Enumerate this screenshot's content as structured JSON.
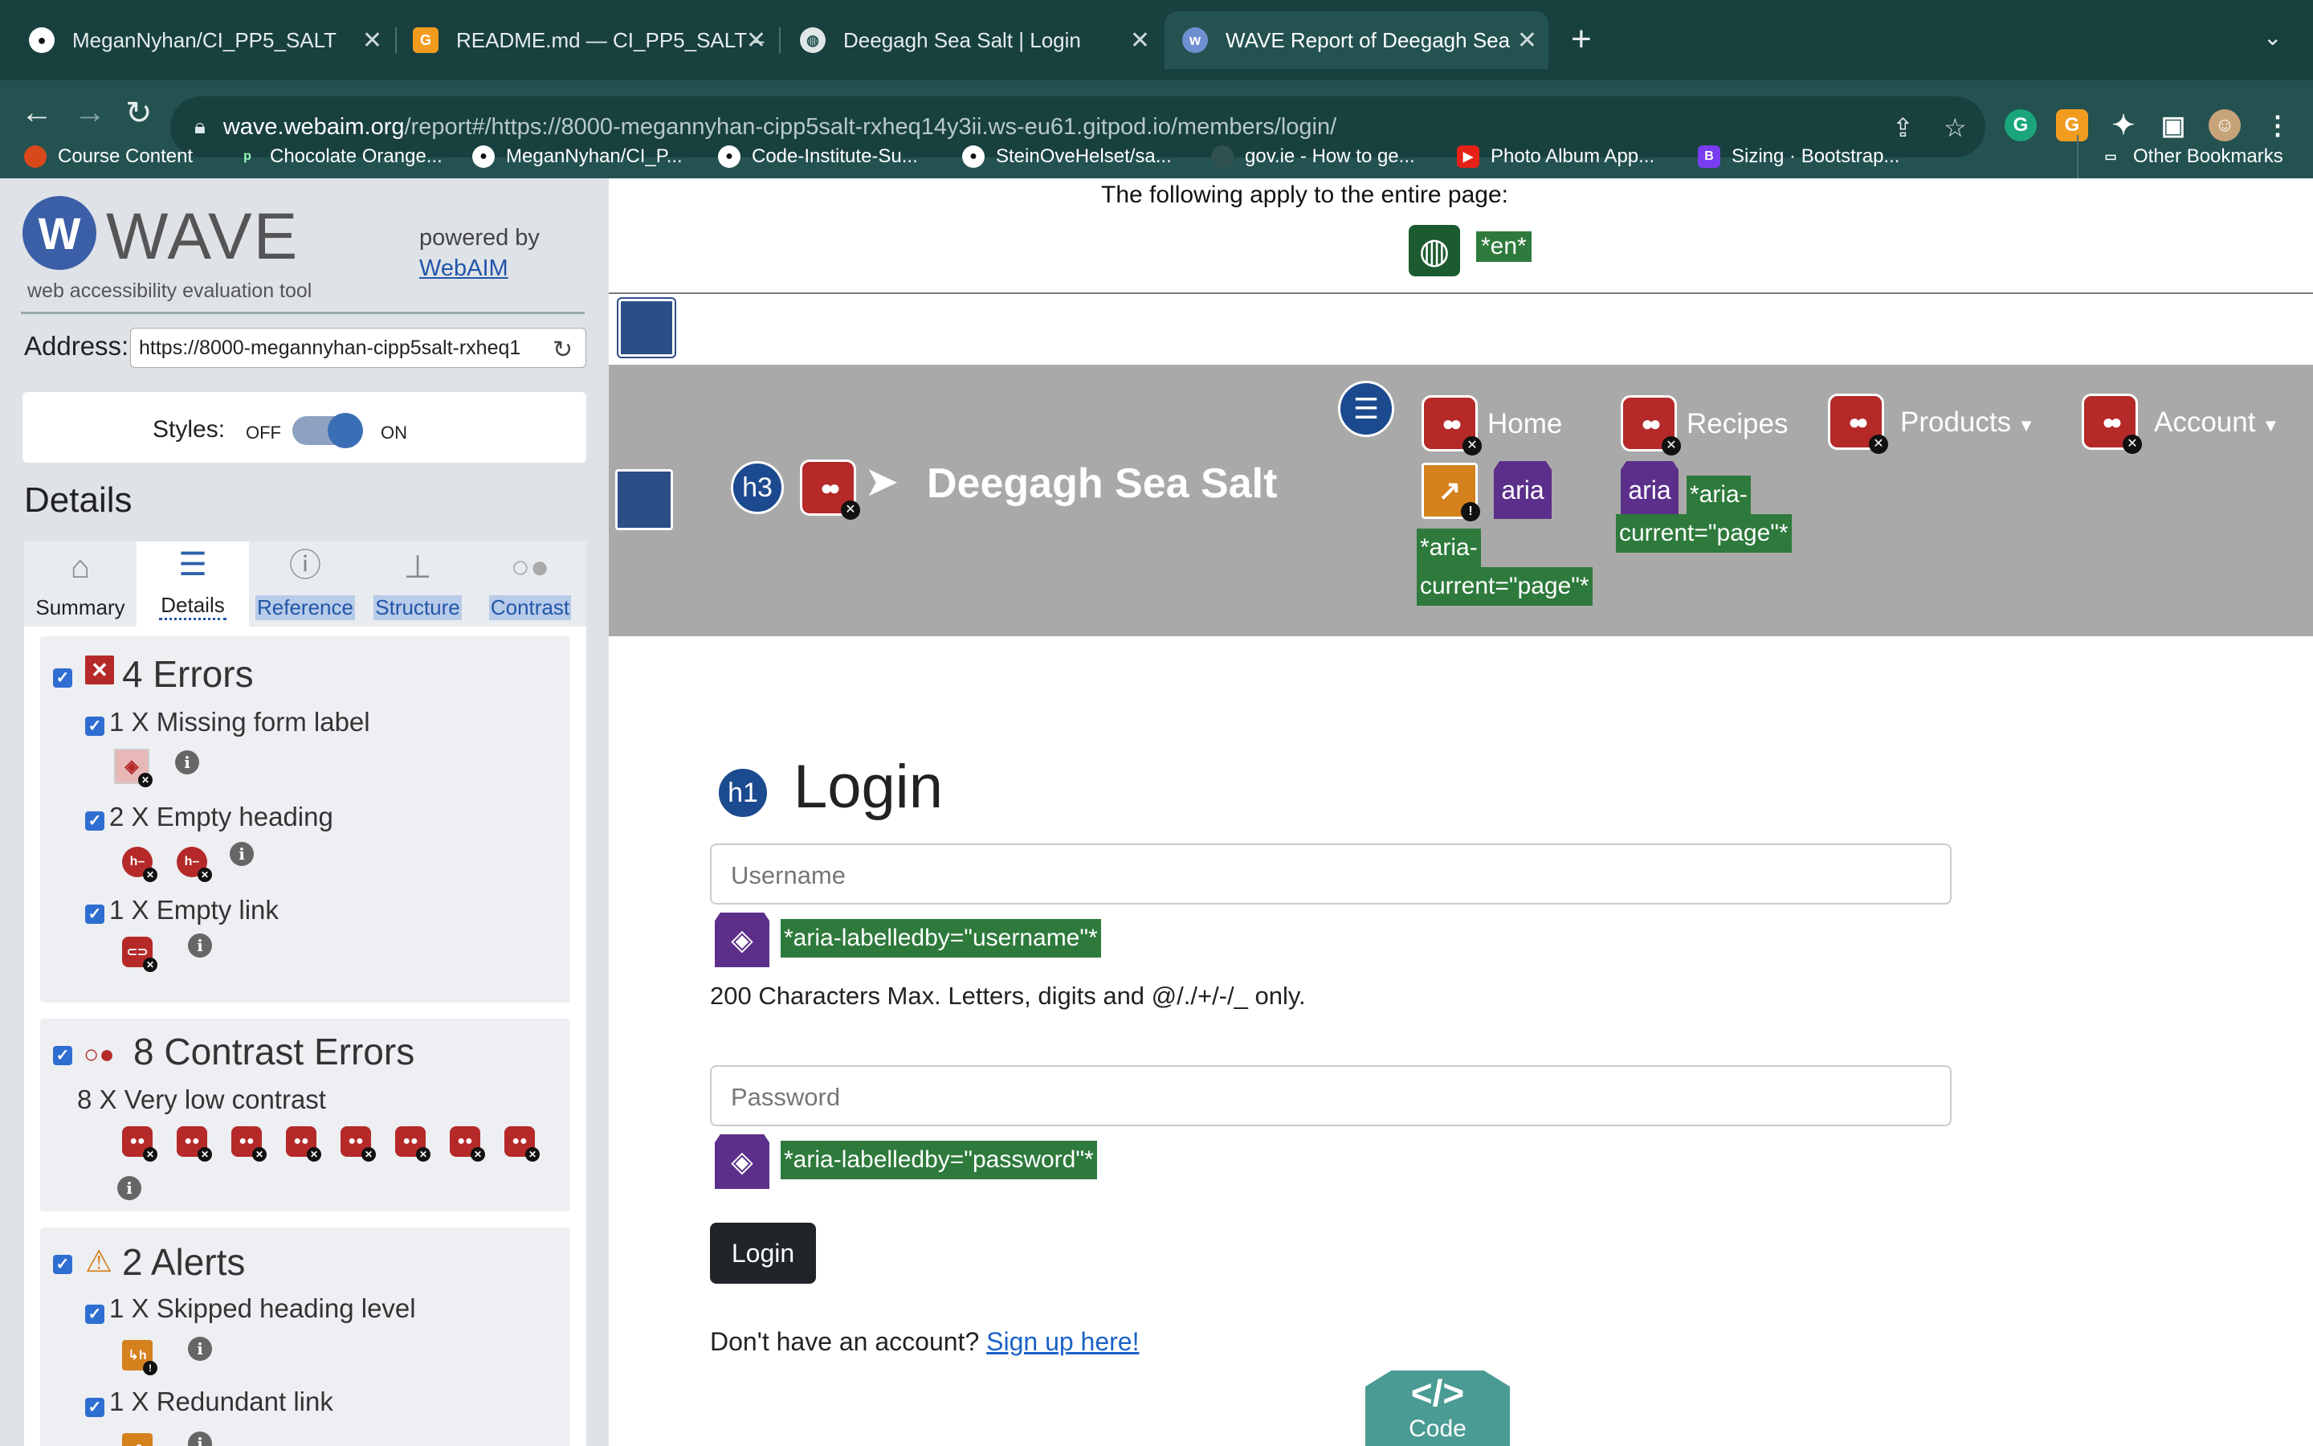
{
  "browser": {
    "tabs": [
      {
        "title": "MeganNyhan/CI_PP5_SALT"
      },
      {
        "title": "README.md — CI_PP5_SALT –"
      },
      {
        "title": "Deegagh Sea Salt | Login"
      },
      {
        "title": "WAVE Report of Deegagh Sea"
      }
    ],
    "url_host": "wave.webaim.org",
    "url_rest": "/report#/https://8000-megannyhan-cipp5salt-rxheq14y3ii.ws-eu61.gitpod.io/members/login/",
    "bookmarks": [
      {
        "label": "Course Content"
      },
      {
        "label": "Chocolate Orange..."
      },
      {
        "label": "MeganNyhan/CI_P..."
      },
      {
        "label": "Code-Institute-Su..."
      },
      {
        "label": "SteinOveHelset/sa..."
      },
      {
        "label": "gov.ie - How to ge..."
      },
      {
        "label": "Photo Album App..."
      },
      {
        "label": "Sizing · Bootstrap..."
      }
    ],
    "other_bookmarks": "Other Bookmarks"
  },
  "wave": {
    "title": "WAVE",
    "subtitle": "web accessibility evaluation tool",
    "powered_by": "powered by",
    "webaim": "WebAIM",
    "address_label": "Address:",
    "address_value": "https://8000-megannyhan-cipp5salt-rxheq1",
    "styles_label": "Styles:",
    "styles_off": "OFF",
    "styles_on": "ON",
    "details_heading": "Details",
    "tabs": [
      {
        "label": "Summary"
      },
      {
        "label": "Details"
      },
      {
        "label": "Reference"
      },
      {
        "label": "Structure"
      },
      {
        "label": "Contrast"
      }
    ],
    "errors": {
      "title": "4 Errors",
      "items": [
        {
          "label": "1 X Missing form label"
        },
        {
          "label": "2 X Empty heading"
        },
        {
          "label": "1 X Empty link"
        }
      ]
    },
    "contrast": {
      "title": "8 Contrast Errors",
      "item": "8 X Very low contrast"
    },
    "alerts": {
      "title": "2 Alerts",
      "items": [
        {
          "label": "1 X Skipped heading level"
        },
        {
          "label": "1 X Redundant link"
        }
      ]
    }
  },
  "page": {
    "note": "The following apply to the entire page:",
    "lang_tag": "*en*",
    "brand": "Deegagh Sea Salt",
    "nav": {
      "home": "Home",
      "recipes": "Recipes",
      "products": "Products",
      "account": "Account"
    },
    "aria_label": "aria",
    "aria_current_tag_home": [
      "*aria-",
      "current=\"page\"*"
    ],
    "aria_current_tag_recipes": [
      "*aria-",
      "current=\"page\"*"
    ],
    "h3_label": "h3",
    "h1_label": "h1",
    "login_title": "Login",
    "username_placeholder": "Username",
    "username_tag": "*aria-labelledby=\"username\"*",
    "help_text": "200 Characters Max. Letters, digits and @/./+/-/_ only.",
    "password_placeholder": "Password",
    "password_tag": "*aria-labelledby=\"password\"*",
    "login_button": "Login",
    "signup_prompt": "Don't have an account?",
    "signup_link": "Sign up here!",
    "code_glyph": "</>",
    "code_label": "Code"
  }
}
